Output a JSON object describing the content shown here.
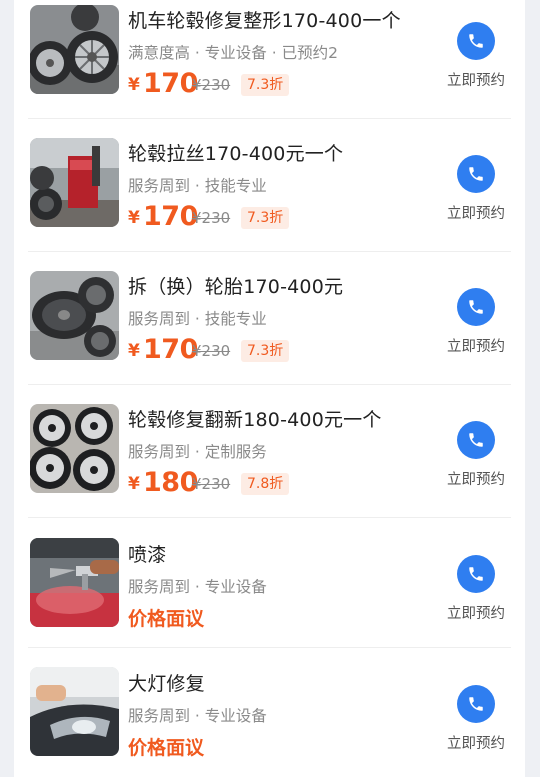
{
  "services": [
    {
      "title": "机车轮毂修复整形170-400一个",
      "tags": "满意度高 · 专业设备 · 已预约2",
      "currency": "¥",
      "price": "170",
      "original_price": "¥230",
      "discount": "7.3折",
      "negotiable": null,
      "action_label": "立即预约",
      "image_icon": "car-wheels-photo"
    },
    {
      "title": "轮毂拉丝170-400元一个",
      "tags": "服务周到 · 技能专业",
      "currency": "¥",
      "price": "170",
      "original_price": "¥230",
      "discount": "7.3折",
      "negotiable": null,
      "action_label": "立即预约",
      "image_icon": "tire-machine-photo"
    },
    {
      "title": "拆（换）轮胎170-400元",
      "tags": "服务周到 · 技能专业",
      "currency": "¥",
      "price": "170",
      "original_price": "¥230",
      "discount": "7.3折",
      "negotiable": null,
      "action_label": "立即预约",
      "image_icon": "tires-photo"
    },
    {
      "title": "轮毂修复翻新180-400元一个",
      "tags": "服务周到 · 定制服务",
      "currency": "¥",
      "price": "180",
      "original_price": "¥230",
      "discount": "7.8折",
      "negotiable": null,
      "action_label": "立即预约",
      "image_icon": "refurbished-rims-photo"
    },
    {
      "title": "喷漆",
      "tags": "服务周到 · 专业设备",
      "currency": null,
      "price": null,
      "original_price": null,
      "discount": null,
      "negotiable": "价格面议",
      "action_label": "立即预约",
      "image_icon": "spray-paint-photo"
    },
    {
      "title": "大灯修复",
      "tags": "服务周到 · 专业设备",
      "currency": null,
      "price": null,
      "original_price": null,
      "discount": null,
      "negotiable": "价格面议",
      "action_label": "立即预约",
      "image_icon": "headlight-photo"
    }
  ],
  "colors": {
    "accent_price": "#f05a1f",
    "call_button": "#2f7ef0",
    "discount_bg": "#fdece4"
  }
}
